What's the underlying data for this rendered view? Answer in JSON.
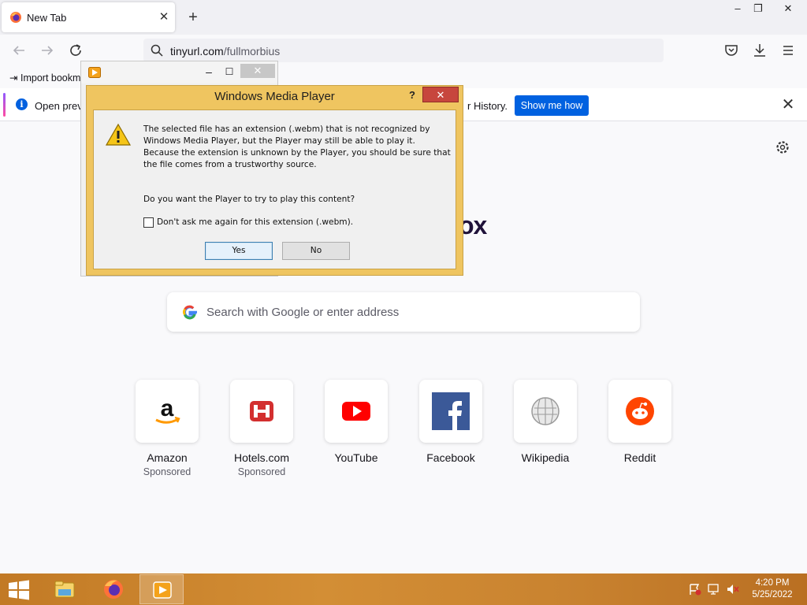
{
  "browser": {
    "tab": {
      "title": "New Tab"
    },
    "url": {
      "host": "tinyurl.com",
      "path": "/fullmorbius"
    },
    "bookmark": {
      "label": "Import bookm"
    },
    "notice": {
      "text_left": "Open previ",
      "text_right": "r History.",
      "button": "Show me how"
    },
    "brand_fragment": "ox",
    "search": {
      "placeholder": "Search with Google or enter address"
    },
    "shortcuts": [
      {
        "name": "Amazon",
        "sub": "Sponsored",
        "icon": "amazon-icon"
      },
      {
        "name": "Hotels.com",
        "sub": "Sponsored",
        "icon": "hotels-icon"
      },
      {
        "name": "YouTube",
        "sub": "",
        "icon": "youtube-icon"
      },
      {
        "name": "Facebook",
        "sub": "",
        "icon": "facebook-icon"
      },
      {
        "name": "Wikipedia",
        "sub": "",
        "icon": "wikipedia-icon"
      },
      {
        "name": "Reddit",
        "sub": "",
        "icon": "reddit-icon"
      }
    ]
  },
  "dialog": {
    "title": "Windows Media Player",
    "help": "?",
    "message": "The selected file has an extension (.webm) that is not recognized by Windows Media Player, but the Player may still be able to play it. Because the extension is unknown by the Player, you should be sure that the file comes from a trustworthy source.",
    "question": "Do you want the Player to try to play this content?",
    "checkbox_label": "Don't ask me again for this extension (.webm).",
    "checkbox_checked": false,
    "yes": "Yes",
    "no": "No"
  },
  "taskbar": {
    "time": "4:20 PM",
    "date": "5/25/2022"
  },
  "colors": {
    "dialog_frame": "#efc560",
    "taskbar": "#c98330",
    "firefox_blue": "#0061e0"
  }
}
